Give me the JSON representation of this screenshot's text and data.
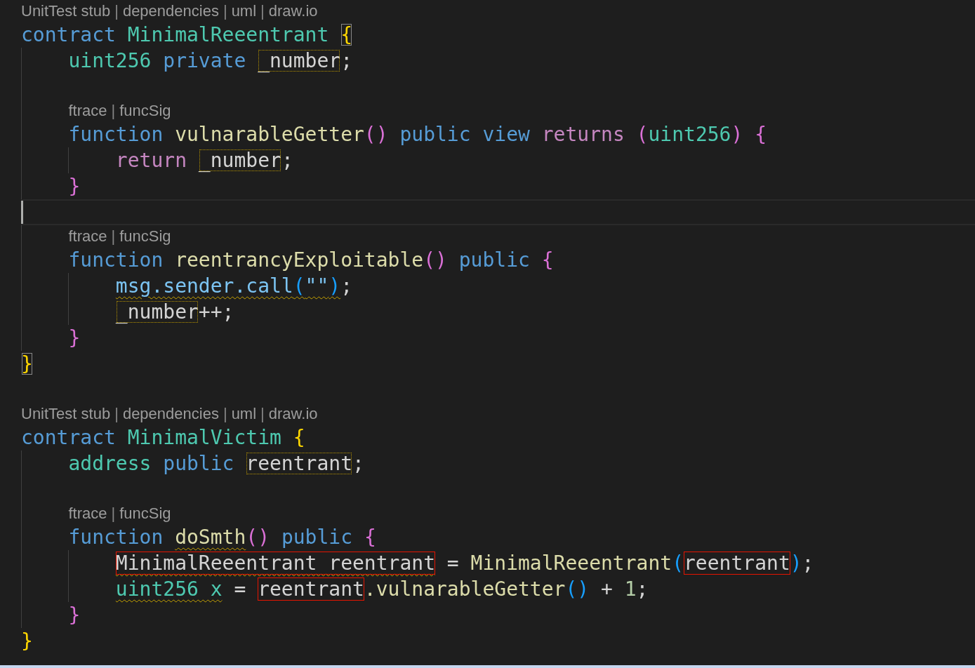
{
  "editor": {
    "lines": [
      {
        "kind": "lens",
        "items": [
          {
            "text": "UnitTest stub",
            "kind": "link"
          },
          {
            "text": "|",
            "kind": "separator"
          },
          {
            "text": "dependencies",
            "kind": "link"
          },
          {
            "text": "|",
            "kind": "separator"
          },
          {
            "text": "uml",
            "kind": "link"
          },
          {
            "text": "|",
            "kind": "separator"
          },
          {
            "text": "draw.io",
            "kind": "link"
          }
        ]
      },
      {
        "kind": "code",
        "tokens": [
          {
            "text": "contract ",
            "color": "#569cd6"
          },
          {
            "text": "MinimalReeentrant ",
            "color": "#4ec9b0"
          },
          {
            "text": "{",
            "color": "#ffd700",
            "bracket_match": true
          }
        ],
        "children": [
          {
            "kind": "code",
            "tokens": [
              {
                "text": "uint256 ",
                "color": "#4ec9b0"
              },
              {
                "text": "private ",
                "color": "#569cd6"
              },
              {
                "text": "_number",
                "color": "#d4d4d4",
                "highlighted": true
              },
              {
                "text": ";",
                "color": "#d4d4d4"
              }
            ]
          },
          {
            "kind": "blank"
          },
          {
            "kind": "lens",
            "items": [
              {
                "text": "ftrace",
                "kind": "link"
              },
              {
                "text": "|",
                "kind": "separator"
              },
              {
                "text": "funcSig",
                "kind": "link"
              }
            ]
          },
          {
            "kind": "code",
            "tokens": [
              {
                "text": "function ",
                "color": "#569cd6"
              },
              {
                "text": "vulnarableGetter",
                "color": "#dcdcaa"
              },
              {
                "text": "() ",
                "color": "#da70d6"
              },
              {
                "text": "public ",
                "color": "#569cd6"
              },
              {
                "text": "view ",
                "color": "#569cd6"
              },
              {
                "text": "returns ",
                "color": "#c586c0"
              },
              {
                "text": "(",
                "color": "#da70d6"
              },
              {
                "text": "uint256",
                "color": "#4ec9b0"
              },
              {
                "text": ") {",
                "color": "#da70d6"
              }
            ],
            "children": [
              {
                "kind": "code",
                "tokens": [
                  {
                    "text": "return ",
                    "color": "#c586c0"
                  },
                  {
                    "text": "_number",
                    "color": "#d4d4d4",
                    "highlighted": true
                  },
                  {
                    "text": ";",
                    "color": "#d4d4d4"
                  }
                ]
              }
            ]
          },
          {
            "kind": "code",
            "tokens": [
              {
                "text": "}",
                "color": "#da70d6"
              }
            ]
          },
          {
            "kind": "blank",
            "current": true
          },
          {
            "kind": "lens",
            "items": [
              {
                "text": "ftrace",
                "kind": "link"
              },
              {
                "text": "|",
                "kind": "separator"
              },
              {
                "text": "funcSig",
                "kind": "link"
              }
            ]
          },
          {
            "kind": "code",
            "tokens": [
              {
                "text": "function ",
                "color": "#569cd6"
              },
              {
                "text": "reentrancyExploitable",
                "color": "#dcdcaa"
              },
              {
                "text": "() ",
                "color": "#da70d6"
              },
              {
                "text": "public ",
                "color": "#569cd6"
              },
              {
                "text": "{",
                "color": "#da70d6"
              }
            ],
            "children": [
              {
                "kind": "code",
                "tokens": [
                  {
                    "text": "msg.sender.call",
                    "color": "#7cc4f2",
                    "squiggle": true
                  },
                  {
                    "text": "(",
                    "color": "#179fff",
                    "squiggle": true
                  },
                  {
                    "text": "\"\"",
                    "color": "#7cc4f2",
                    "squiggle": true
                  },
                  {
                    "text": ")",
                    "color": "#179fff",
                    "squiggle": true
                  },
                  {
                    "text": ";",
                    "color": "#d4d4d4"
                  }
                ]
              },
              {
                "kind": "code",
                "tokens": [
                  {
                    "text": "_number",
                    "color": "#d4d4d4",
                    "highlighted": true
                  },
                  {
                    "text": "++;",
                    "color": "#d4d4d4"
                  }
                ]
              }
            ]
          },
          {
            "kind": "code",
            "tokens": [
              {
                "text": "}",
                "color": "#da70d6"
              }
            ]
          }
        ]
      },
      {
        "kind": "code",
        "tokens": [
          {
            "text": "}",
            "color": "#ffd700",
            "bracket_match": true
          }
        ]
      },
      {
        "kind": "blank"
      },
      {
        "kind": "lens",
        "items": [
          {
            "text": "UnitTest stub",
            "kind": "link"
          },
          {
            "text": "|",
            "kind": "separator"
          },
          {
            "text": "dependencies",
            "kind": "link"
          },
          {
            "text": "|",
            "kind": "separator"
          },
          {
            "text": "uml",
            "kind": "link"
          },
          {
            "text": "|",
            "kind": "separator"
          },
          {
            "text": "draw.io",
            "kind": "link"
          }
        ]
      },
      {
        "kind": "code",
        "tokens": [
          {
            "text": "contract ",
            "color": "#569cd6"
          },
          {
            "text": "MinimalVictim ",
            "color": "#4ec9b0"
          },
          {
            "text": "{",
            "color": "#ffd700"
          }
        ],
        "children": [
          {
            "kind": "code",
            "tokens": [
              {
                "text": "address ",
                "color": "#4ec9b0"
              },
              {
                "text": "public ",
                "color": "#569cd6"
              },
              {
                "text": "reentrant",
                "color": "#d4d4d4",
                "highlighted": true
              },
              {
                "text": ";",
                "color": "#d4d4d4"
              }
            ]
          },
          {
            "kind": "blank"
          },
          {
            "kind": "lens",
            "items": [
              {
                "text": "ftrace",
                "kind": "link"
              },
              {
                "text": "|",
                "kind": "separator"
              },
              {
                "text": "funcSig",
                "kind": "link"
              }
            ]
          },
          {
            "kind": "code",
            "tokens": [
              {
                "text": "function ",
                "color": "#569cd6"
              },
              {
                "text": "doSmth",
                "color": "#dcdcaa",
                "squiggle": true
              },
              {
                "text": "() ",
                "color": "#da70d6"
              },
              {
                "text": "public ",
                "color": "#569cd6"
              },
              {
                "text": "{",
                "color": "#da70d6"
              }
            ],
            "children": [
              {
                "kind": "code",
                "tokens": [
                  {
                    "text": "MinimalReeentrant reentrant",
                    "color": "#d4d4d4",
                    "error": true,
                    "squiggle": true
                  },
                  {
                    "text": " = ",
                    "color": "#d4d4d4"
                  },
                  {
                    "text": "MinimalReeentrant",
                    "color": "#dcdcaa"
                  },
                  {
                    "text": "(",
                    "color": "#179fff"
                  },
                  {
                    "text": "reentrant",
                    "color": "#d4d4d4",
                    "error": true
                  },
                  {
                    "text": ")",
                    "color": "#179fff"
                  },
                  {
                    "text": ";",
                    "color": "#d4d4d4"
                  }
                ]
              },
              {
                "kind": "code",
                "tokens": [
                  {
                    "text": "uint256 x",
                    "color": "#4ec9b0",
                    "squiggle": true
                  },
                  {
                    "text": " = ",
                    "color": "#d4d4d4"
                  },
                  {
                    "text": "reentrant",
                    "color": "#d4d4d4",
                    "error": true
                  },
                  {
                    "text": ".vulnarableGetter",
                    "color": "#dcdcaa"
                  },
                  {
                    "text": "()",
                    "color": "#179fff"
                  },
                  {
                    "text": " + ",
                    "color": "#d4d4d4"
                  },
                  {
                    "text": "1",
                    "color": "#b5cea8"
                  },
                  {
                    "text": ";",
                    "color": "#d4d4d4"
                  }
                ]
              }
            ]
          },
          {
            "kind": "code",
            "tokens": [
              {
                "text": "}",
                "color": "#da70d6"
              }
            ]
          }
        ]
      },
      {
        "kind": "code",
        "tokens": [
          {
            "text": "}",
            "color": "#ffd700"
          }
        ]
      }
    ]
  }
}
